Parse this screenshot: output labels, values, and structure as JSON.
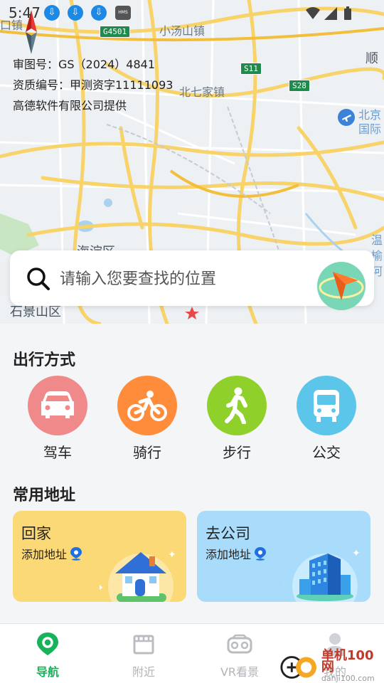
{
  "status_bar": {
    "time": "5:47",
    "hms_label": "HMS"
  },
  "map": {
    "approval_lines": [
      "审图号：GS（2024）4841",
      "资质编号：甲测资字11111093",
      "高德软件有限公司提供"
    ],
    "place_labels": {
      "xiaotangshan": "小汤山镇",
      "beiqijia": "北七家镇",
      "shun": "顺",
      "beijing_airport_1": "北京",
      "beijing_airport_2": "国际",
      "haidian": "海淀区",
      "shijingshan": "石景山区",
      "wenyu_1": "温",
      "wenyu_2": "榆",
      "wenyu_3": "河",
      "kou_zhen": "口镇"
    },
    "highways": {
      "g4501": "G4501",
      "s11": "S11",
      "s28": "S28"
    }
  },
  "search": {
    "placeholder": "请输入您要查找的位置"
  },
  "travel": {
    "title": "出行方式",
    "modes": [
      {
        "label": "驾车",
        "icon": "car-icon",
        "color": "#f08a8a"
      },
      {
        "label": "骑行",
        "icon": "bike-icon",
        "color": "#ff8c3a"
      },
      {
        "label": "步行",
        "icon": "walk-icon",
        "color": "#8fd12a"
      },
      {
        "label": "公交",
        "icon": "bus-icon",
        "color": "#5cc6ea"
      }
    ]
  },
  "addresses": {
    "title": "常用地址",
    "home": {
      "title": "回家",
      "sub": "添加地址",
      "color": "#fcd977"
    },
    "company": {
      "title": "去公司",
      "sub": "添加地址",
      "color": "#a9dcfa"
    }
  },
  "bottom_nav": {
    "items": [
      {
        "label": "导航",
        "active": true
      },
      {
        "label": "附近",
        "active": false
      },
      {
        "label": "VR看景",
        "active": false
      },
      {
        "label": "我的",
        "active": false
      }
    ]
  },
  "watermark": {
    "line1": "单机100网",
    "line2": "danji100.com"
  }
}
